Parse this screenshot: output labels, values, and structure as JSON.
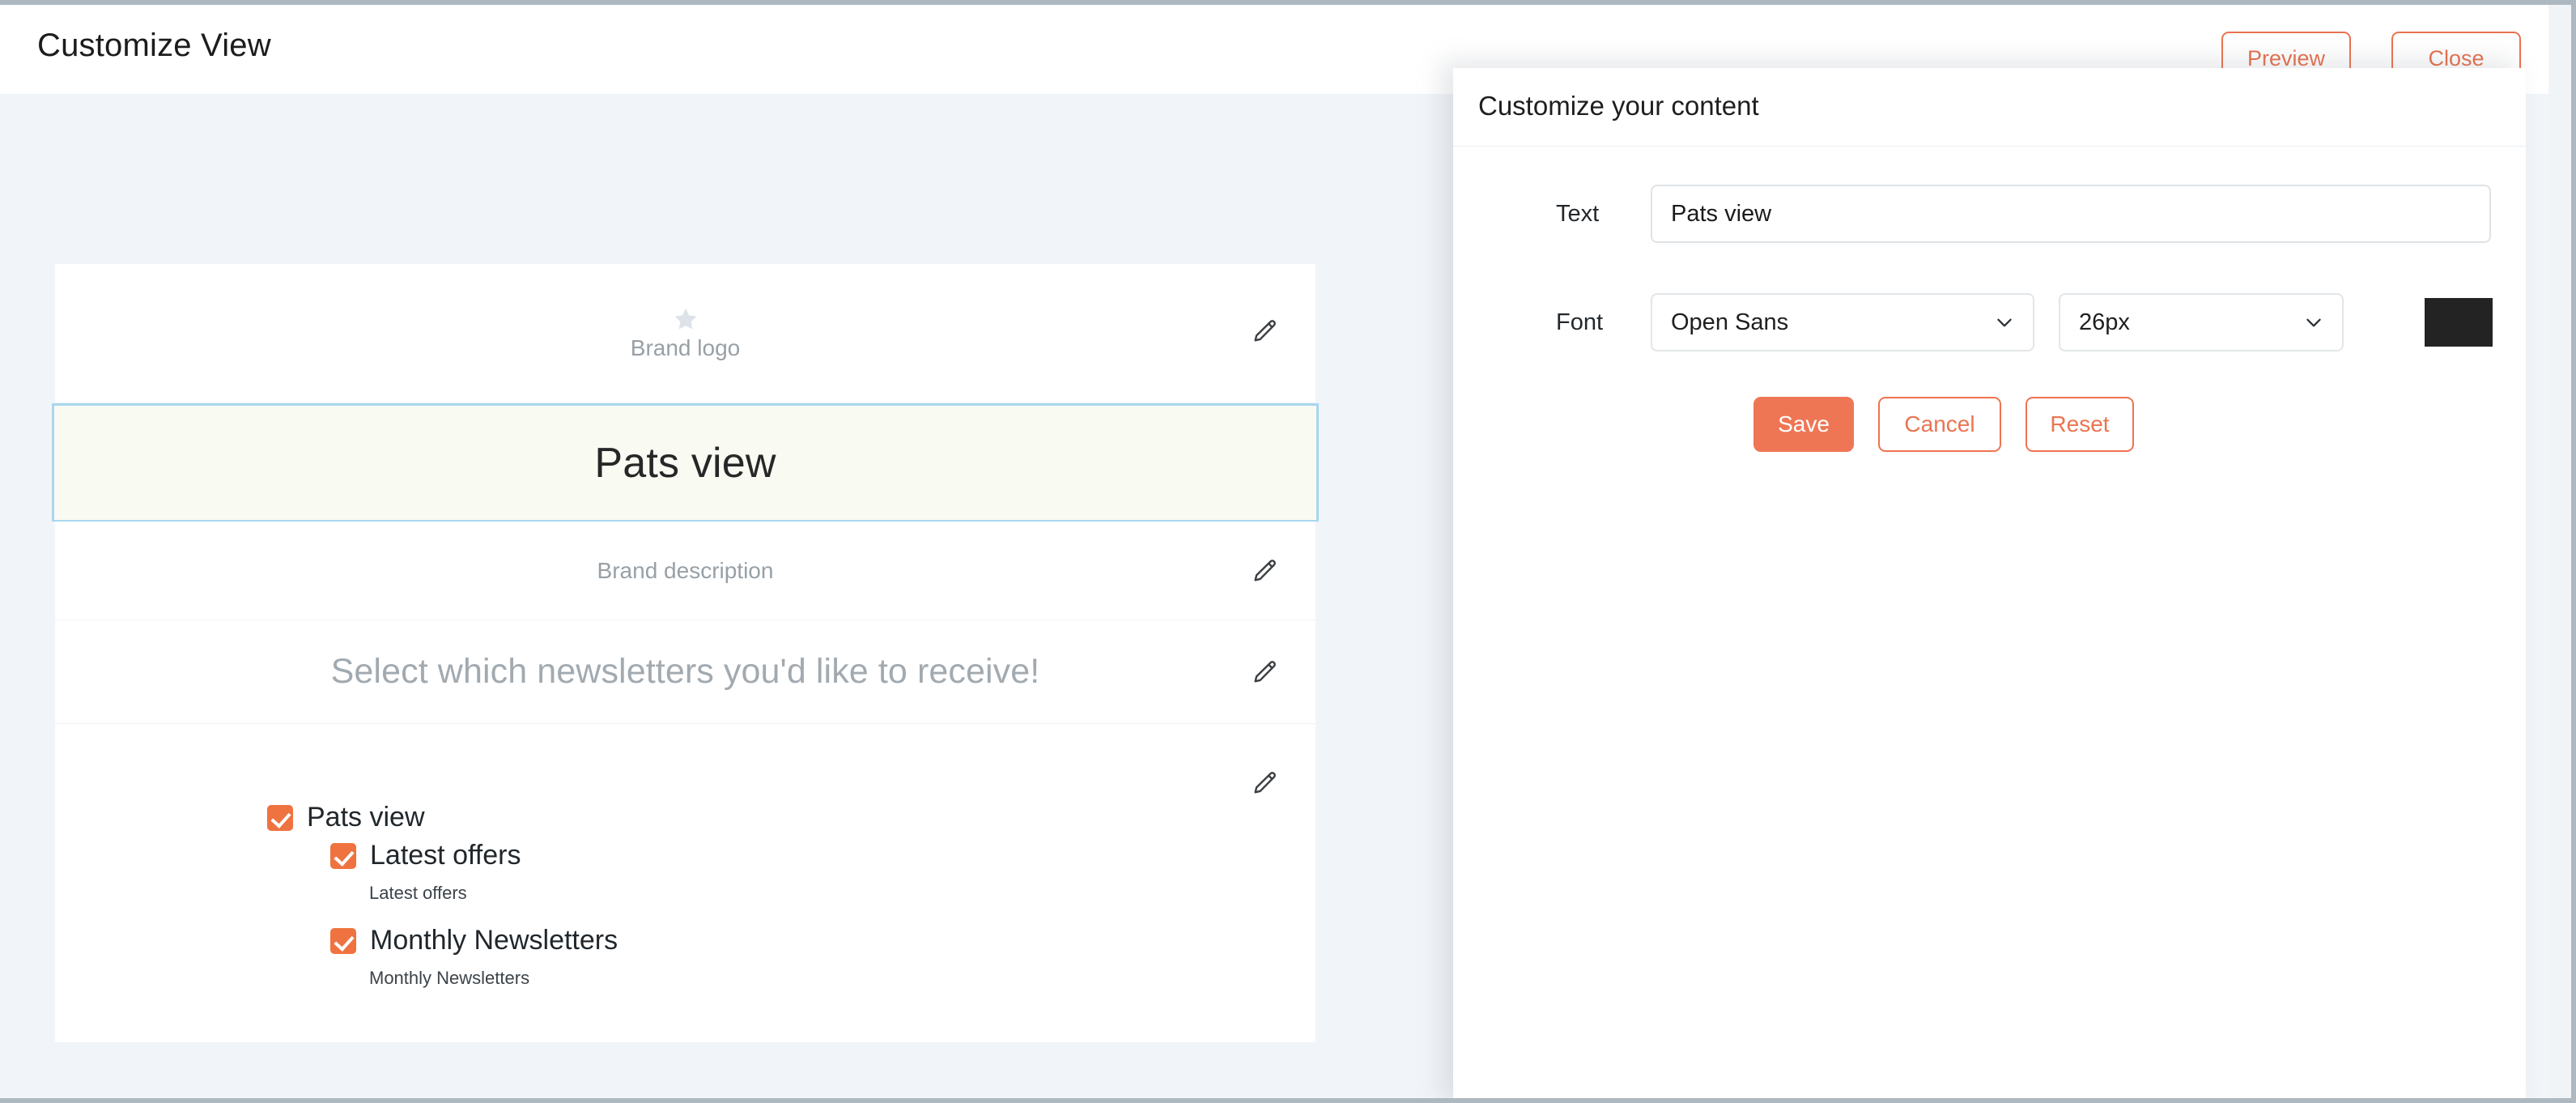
{
  "header": {
    "title": "Customize View",
    "preview_label": "Preview",
    "close_label": "Close"
  },
  "preview_card": {
    "brand_logo": {
      "icon": "star-icon",
      "label": "Brand logo",
      "edit_icon": "pencil-icon"
    },
    "title_block": {
      "text": "Pats view",
      "selected": true,
      "border_color": "#a9d6ef",
      "background_color": "#f9faf2"
    },
    "brand_description": {
      "label": "Brand description",
      "edit_icon": "pencil-icon"
    },
    "select_prompt": {
      "label": "Select which newsletters you'd like to receive!",
      "edit_icon": "pencil-icon"
    },
    "checkbox_block": {
      "edit_icon": "pencil-icon",
      "items": [
        {
          "label": "Pats view",
          "checked": true,
          "level": 0,
          "sub": null
        },
        {
          "label": "Latest offers",
          "checked": true,
          "level": 1,
          "sub": "Latest offers"
        },
        {
          "label": "Monthly Newsletters",
          "checked": true,
          "level": 1,
          "sub": "Monthly Newsletters"
        }
      ]
    }
  },
  "side_panel": {
    "title": "Customize your content",
    "text_field": {
      "label": "Text",
      "value": "Pats view",
      "placeholder": "Enter text"
    },
    "font_field": {
      "label": "Font",
      "family": "Open Sans",
      "size": "26px",
      "color": "#232323",
      "caret_icon": "chevron-down-icon"
    },
    "actions": {
      "save_label": "Save",
      "cancel_label": "Cancel",
      "reset_label": "Reset"
    }
  },
  "colors": {
    "accent": "#ef7340",
    "accent_outline": "#ee7350",
    "page_background": "#f1f5f9",
    "selected_border": "#a9d6ef",
    "selected_background": "#f9faf2",
    "window_border": "#aeb8c0"
  }
}
